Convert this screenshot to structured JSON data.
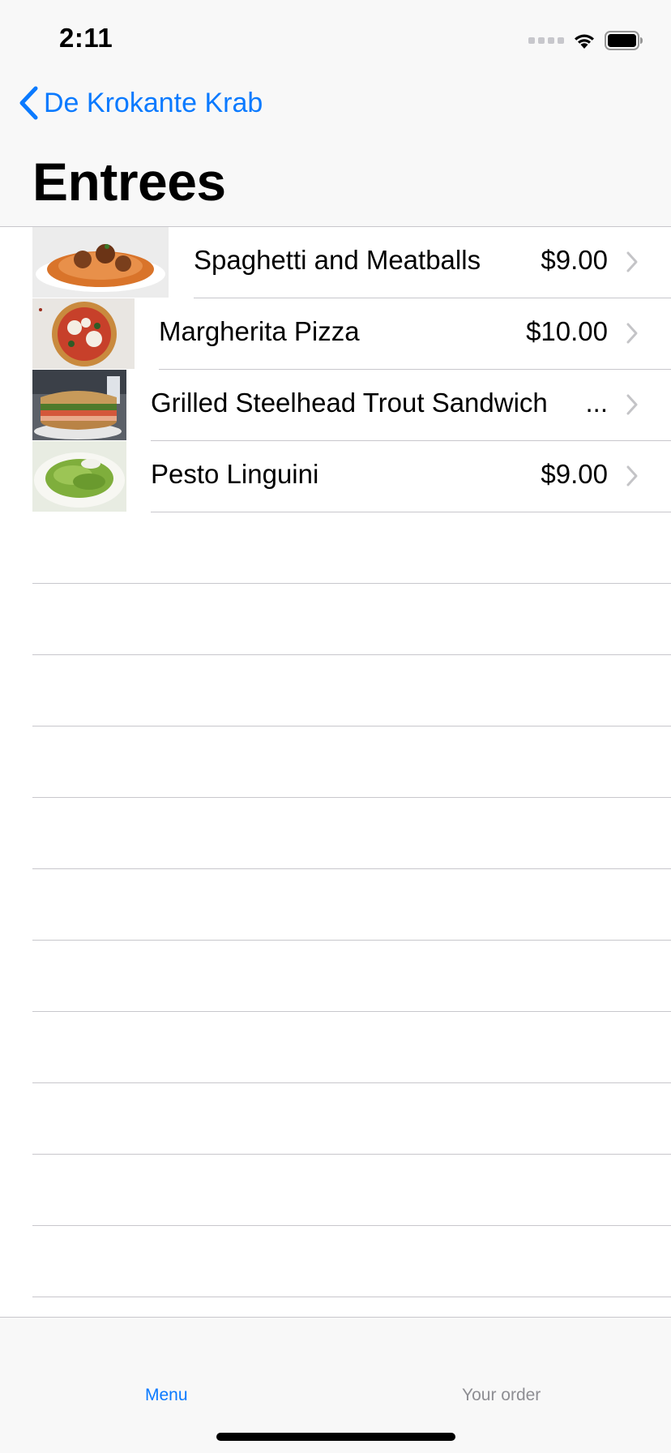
{
  "status_bar": {
    "time": "2:11"
  },
  "nav": {
    "back_label": "De Krokante Krab",
    "title": "Entrees"
  },
  "menu_items": [
    {
      "name": "Spaghetti and Meatballs",
      "price": "$9.00"
    },
    {
      "name": "Margherita Pizza",
      "price": "$10.00"
    },
    {
      "name": "Grilled Steelhead Trout Sandwich",
      "price": "..."
    },
    {
      "name": "Pesto Linguini",
      "price": "$9.00"
    }
  ],
  "tab_bar": {
    "menu_label": "Menu",
    "order_label": "Your order"
  },
  "colors": {
    "accent": "#0a7aff",
    "separator": "#c8c7cc",
    "inactive_tab": "#8e8e93"
  }
}
